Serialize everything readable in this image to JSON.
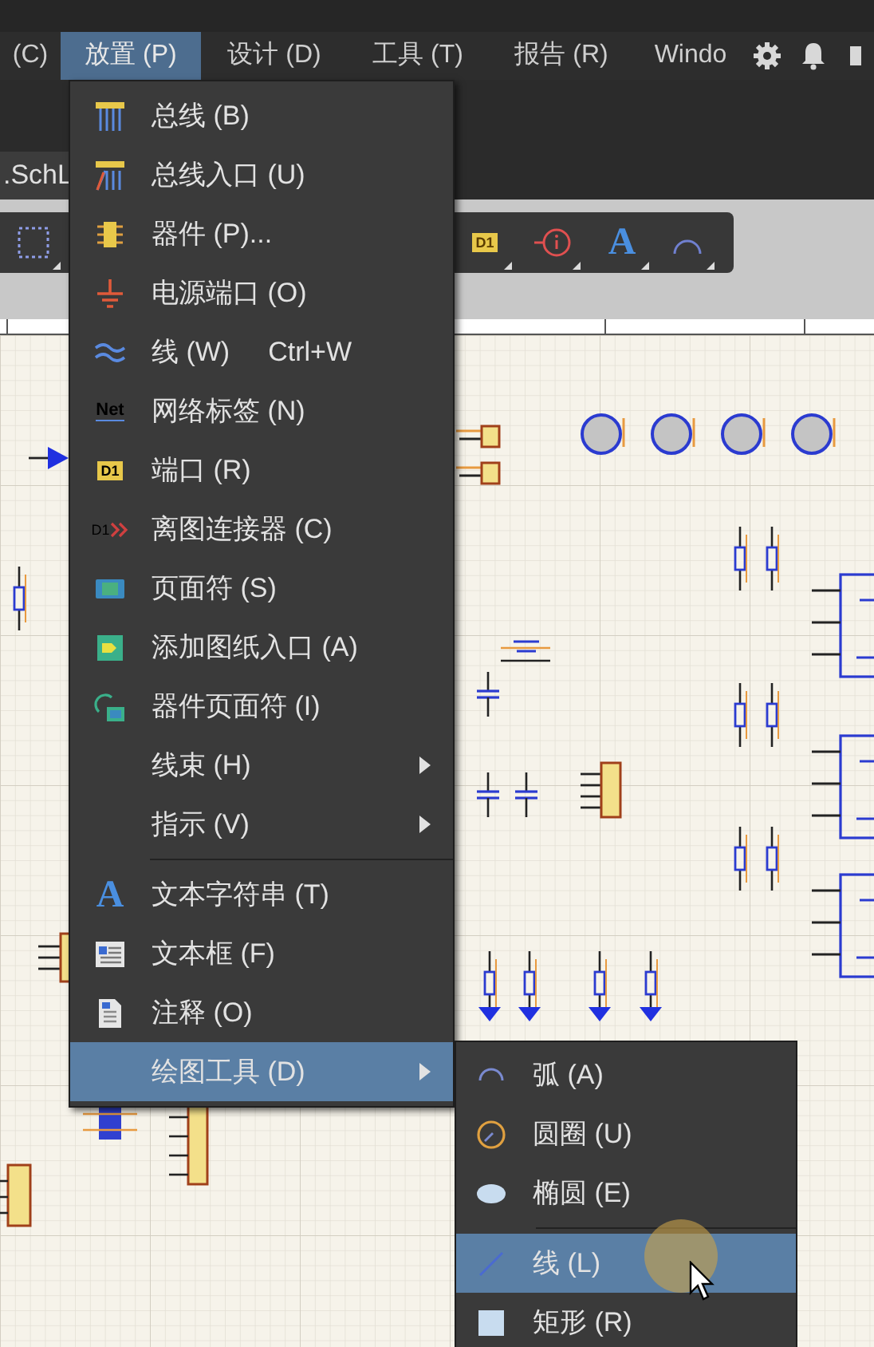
{
  "menubar": [
    {
      "label": "(C)",
      "selected": false
    },
    {
      "label": "放置 (P)",
      "selected": true
    },
    {
      "label": "设计 (D)",
      "selected": false
    },
    {
      "label": "工具 (T)",
      "selected": false
    },
    {
      "label": "报告 (R)",
      "selected": false
    },
    {
      "label": "Windo",
      "selected": false
    }
  ],
  "document_tab": {
    "label": ".SchL"
  },
  "toolbar_icon_texts": [
    "D1",
    "A"
  ],
  "place_menu": {
    "sections": [
      [
        {
          "label": "总线 (B)",
          "has_submenu": false,
          "selected": false
        },
        {
          "label": "总线入口 (U)",
          "has_submenu": false,
          "selected": false
        },
        {
          "label": "器件 (P)...",
          "has_submenu": false,
          "selected": false
        },
        {
          "label": "电源端口 (O)",
          "has_submenu": false,
          "selected": false
        },
        {
          "label": "线 (W)",
          "shortcut": "Ctrl+W",
          "has_submenu": false,
          "selected": false
        },
        {
          "label": "网络标签 (N)",
          "icon_text": "Net",
          "has_submenu": false,
          "selected": false
        },
        {
          "label": "端口 (R)",
          "icon_text": "D1",
          "has_submenu": false,
          "selected": false
        },
        {
          "label": "离图连接器 (C)",
          "icon_text": "D1",
          "has_submenu": false,
          "selected": false
        },
        {
          "label": "页面符 (S)",
          "has_submenu": false,
          "selected": false
        },
        {
          "label": "添加图纸入口 (A)",
          "has_submenu": false,
          "selected": false
        },
        {
          "label": "器件页面符 (I)",
          "has_submenu": false,
          "selected": false
        },
        {
          "label": "线束 (H)",
          "has_submenu": true,
          "selected": false
        },
        {
          "label": "指示 (V)",
          "has_submenu": true,
          "selected": false
        }
      ],
      [
        {
          "label": "文本字符串 (T)",
          "icon_text": "A",
          "has_submenu": false,
          "selected": false
        },
        {
          "label": "文本框 (F)",
          "has_submenu": false,
          "selected": false
        },
        {
          "label": "注释 (O)",
          "has_submenu": false,
          "selected": false
        },
        {
          "label": "绘图工具 (D)",
          "has_submenu": true,
          "selected": true
        }
      ]
    ]
  },
  "drawing_tools_menu": {
    "sections": [
      [
        {
          "label": "弧 (A)",
          "selected": false
        },
        {
          "label": "圆圈 (U)",
          "selected": false
        },
        {
          "label": "椭圆 (E)",
          "selected": false
        }
      ],
      [
        {
          "label": "线 (L)",
          "selected": true
        },
        {
          "label": "矩形 (R)",
          "selected": false
        }
      ]
    ]
  }
}
